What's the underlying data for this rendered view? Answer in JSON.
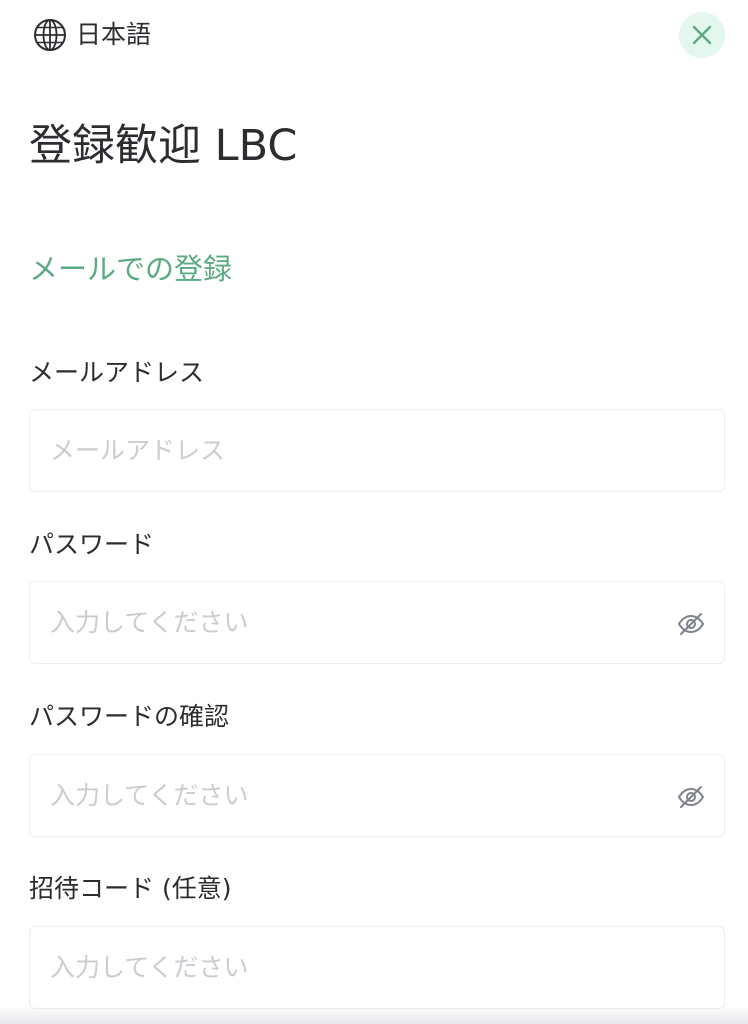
{
  "header": {
    "language_label": "日本語",
    "language_icon": "globe-icon",
    "close_icon": "close-icon",
    "close_color": "#5caa82",
    "close_bg": "#e3f7ee"
  },
  "page": {
    "title": "登録歓迎 LBC",
    "tab_label": "メールでの登録",
    "accent_color": "#5caa82"
  },
  "form": {
    "email": {
      "label": "メールアドレス",
      "placeholder": "メールアドレス",
      "value": ""
    },
    "password": {
      "label": "パスワード",
      "placeholder": "入力してください",
      "value": "",
      "toggle_icon": "eye-off-icon"
    },
    "confirm_password": {
      "label": "パスワードの確認",
      "placeholder": "入力してください",
      "value": "",
      "toggle_icon": "eye-off-icon"
    },
    "invite_code": {
      "label": "招待コード (任意)",
      "placeholder": "入力してください",
      "value": ""
    }
  }
}
